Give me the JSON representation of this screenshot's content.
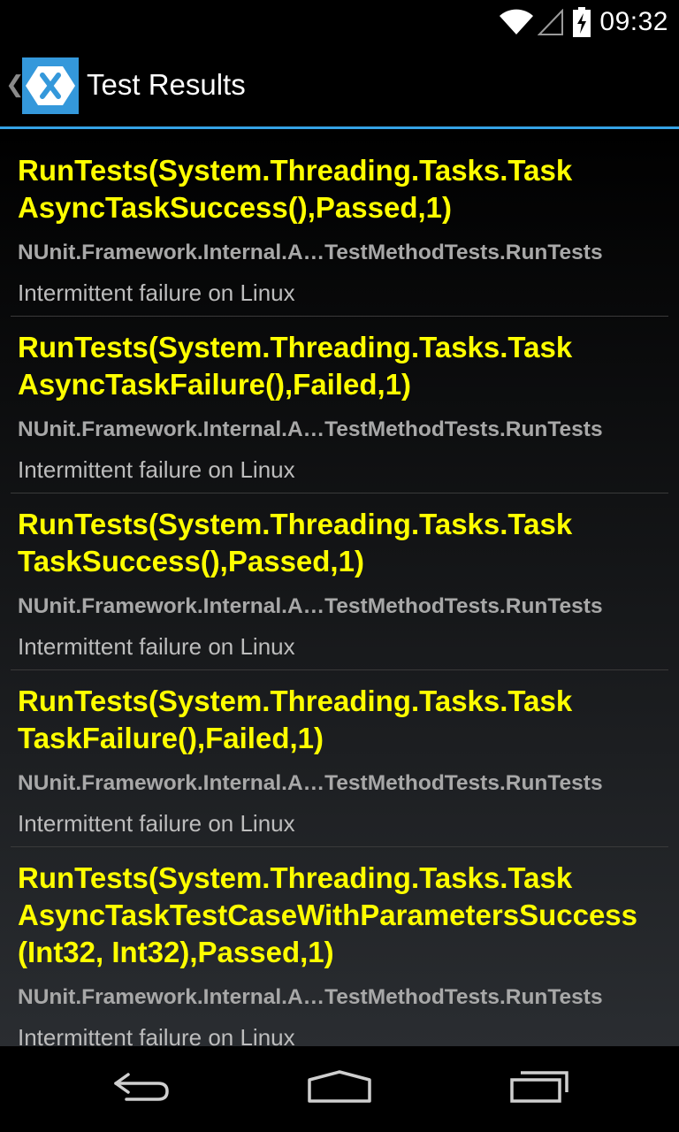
{
  "status_bar": {
    "time": "09:32",
    "icons": [
      "wifi-icon",
      "signal-icon",
      "battery-charging-icon"
    ]
  },
  "action_bar": {
    "title": "Test Results",
    "app_icon": "xamarin-logo-icon",
    "up_icon": "up-caret-icon"
  },
  "results": [
    {
      "title": "RunTests(System.Threading.Tasks.Task\nAsyncTaskSuccess(),Passed,1)",
      "subtitle": "NUnit.Framework.Internal.A…TestMethodTests.RunTests",
      "message": "Intermittent failure on Linux"
    },
    {
      "title": "RunTests(System.Threading.Tasks.Task\nAsyncTaskFailure(),Failed,1)",
      "subtitle": "NUnit.Framework.Internal.A…TestMethodTests.RunTests",
      "message": "Intermittent failure on Linux"
    },
    {
      "title": "RunTests(System.Threading.Tasks.Task\nTaskSuccess(),Passed,1)",
      "subtitle": "NUnit.Framework.Internal.A…TestMethodTests.RunTests",
      "message": "Intermittent failure on Linux"
    },
    {
      "title": "RunTests(System.Threading.Tasks.Task\nTaskFailure(),Failed,1)",
      "subtitle": "NUnit.Framework.Internal.A…TestMethodTests.RunTests",
      "message": "Intermittent failure on Linux"
    },
    {
      "title": "RunTests(System.Threading.Tasks.Task\nAsyncTaskTestCaseWithParametersSuccess\n(Int32, Int32),Passed,1)",
      "subtitle": "NUnit.Framework.Internal.A…TestMethodTests.RunTests",
      "message": "Intermittent failure on Linux"
    }
  ],
  "nav_bar": {
    "icons": [
      "back-icon",
      "home-icon",
      "recents-icon"
    ]
  },
  "colors": {
    "title_yellow": "#ffff00",
    "accent_blue": "#35a3e6",
    "subtitle_gray": "#a8a8a8"
  }
}
